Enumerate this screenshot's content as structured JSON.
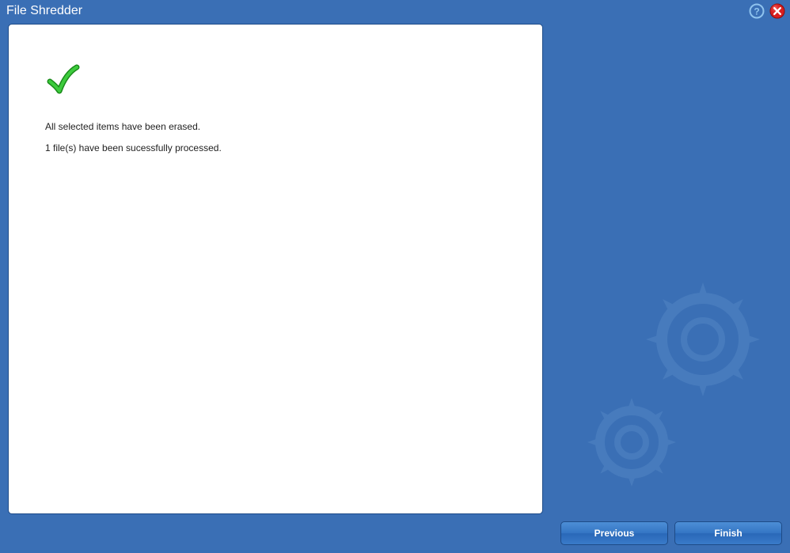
{
  "window": {
    "title": "File Shredder"
  },
  "main": {
    "message1": "All selected items have been erased.",
    "message2": "1 file(s) have been sucessfully processed."
  },
  "buttons": {
    "previous": "Previous",
    "finish": "Finish"
  }
}
